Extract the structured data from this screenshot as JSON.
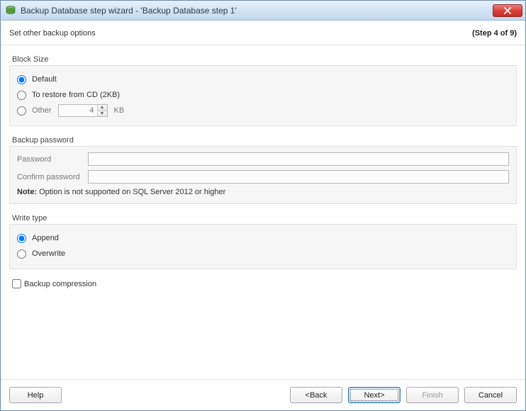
{
  "window": {
    "title": "Backup Database step wizard - 'Backup Database step 1'"
  },
  "header": {
    "subtitle": "Set other backup options",
    "step_indicator": "(Step 4 of 9)"
  },
  "block_size": {
    "legend": "Block Size",
    "default_label": "Default",
    "restore_cd_label": "To restore from CD (2KB)",
    "other_label": "Other",
    "other_value": "4",
    "other_unit": "KB",
    "selected": "default"
  },
  "backup_password": {
    "legend": "Backup password",
    "password_label": "Password",
    "confirm_label": "Confirm password",
    "password_value": "",
    "confirm_value": "",
    "note_label": "Note:",
    "note_text": " Option is not supported on SQL Server 2012 or higher"
  },
  "write_type": {
    "legend": "Write type",
    "append_label": "Append",
    "overwrite_label": "Overwrite",
    "selected": "append"
  },
  "compression": {
    "label": "Backup compression",
    "checked": false
  },
  "buttons": {
    "help": "Help",
    "back": "<Back",
    "next": "Next>",
    "finish": "Finish",
    "cancel": "Cancel"
  }
}
